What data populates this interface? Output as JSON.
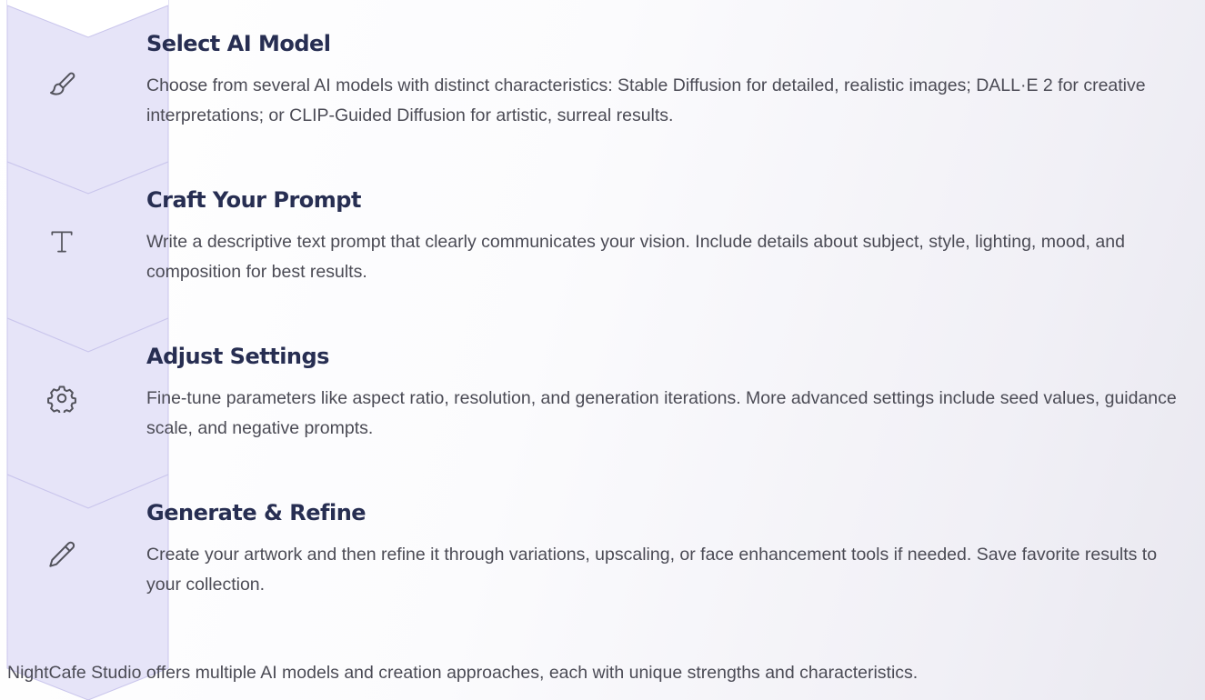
{
  "steps": [
    {
      "icon": "paintbrush-icon",
      "title": "Select AI Model",
      "description": "Choose from several AI models with distinct characteristics: Stable Diffusion for detailed, realistic images; DALL·E 2 for creative interpretations; or CLIP-Guided Diffusion for artistic, surreal results."
    },
    {
      "icon": "text-type-icon",
      "title": "Craft Your Prompt",
      "description": "Write a descriptive text prompt that clearly communicates your vision. Include details about subject, style, lighting, mood, and composition for best results."
    },
    {
      "icon": "gear-icon",
      "title": "Adjust Settings",
      "description": "Fine-tune parameters like aspect ratio, resolution, and generation iterations. More advanced settings include seed values, guidance scale, and negative prompts."
    },
    {
      "icon": "pencil-icon",
      "title": "Generate & Refine",
      "description": "Create your artwork and then refine it through variations, upscaling, or face enhancement tools if needed. Save favorite results to your collection."
    }
  ],
  "footer": {
    "text": "NightCafe Studio offers multiple AI models and creation approaches, each with unique strengths and characteristics."
  },
  "colors": {
    "chevron_fill": "#e6e4f8",
    "chevron_stroke": "#c9c5ec",
    "title": "#272e52",
    "body_text": "#4b4b55"
  }
}
